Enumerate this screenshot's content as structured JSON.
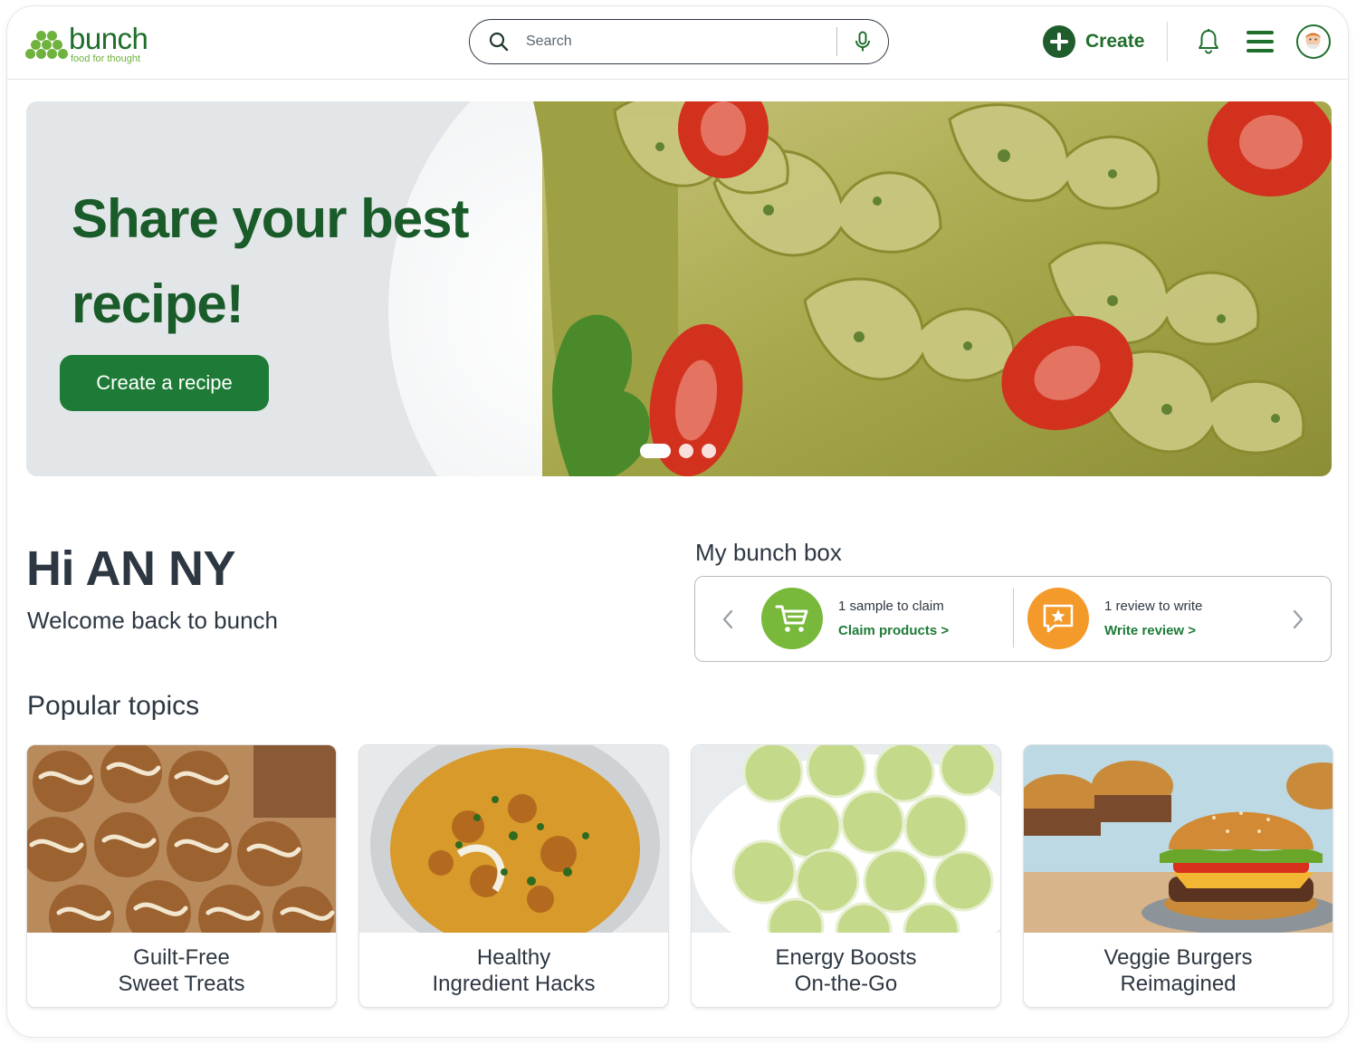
{
  "brand": {
    "name": "bunch",
    "tagline": "food for thought",
    "primary_color": "#1f6e2b",
    "accent_color": "#6fb23d"
  },
  "header": {
    "search_placeholder": "Search",
    "create_label": "Create",
    "icons": [
      "search-icon",
      "microphone-icon",
      "plus-icon",
      "bell-icon",
      "hamburger-menu-icon",
      "avatar"
    ]
  },
  "hero": {
    "title": "Share your best recipe!",
    "cta_label": "Create a recipe",
    "slides_total": 3,
    "active_slide": 1
  },
  "greeting": {
    "title": "Hi AN NY",
    "subtitle": "Welcome back to bunch"
  },
  "bunch_box": {
    "title": "My bunch box",
    "items": [
      {
        "line1": "1 sample to claim",
        "action": "Claim products >",
        "icon": "shopping-cart-icon",
        "color": "#78b83a"
      },
      {
        "line1": "1 review to write",
        "action": "Write review >",
        "icon": "review-star-icon",
        "color": "#f39a2b"
      }
    ]
  },
  "popular_topics": {
    "title": "Popular topics",
    "cards": [
      {
        "line1": "Guilt-Free",
        "line2": "Sweet Treats"
      },
      {
        "line1": "Healthy",
        "line2": "Ingredient Hacks"
      },
      {
        "line1": "Energy Boosts",
        "line2": "On-the-Go"
      },
      {
        "line1": "Veggie Burgers",
        "line2": "Reimagined"
      }
    ]
  }
}
